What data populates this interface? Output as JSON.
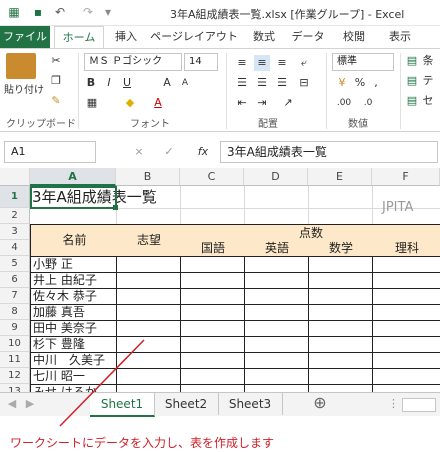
{
  "window": {
    "title": "3年A組成績表一覧.xlsx  [作業グループ] - Excel"
  },
  "tabs": [
    "ファイル",
    "ホーム",
    "挿入",
    "ページレイアウト",
    "数式",
    "データ",
    "校閲",
    "表示"
  ],
  "ribbon": {
    "paste_label": "貼り付け",
    "font_name": "ＭＳ Ｐゴシック",
    "font_size": "14",
    "number_format": "標準",
    "bold": "B",
    "italic": "I",
    "underline": "U",
    "font_a_up": "A",
    "font_a_down": "A",
    "comma": ",",
    "percent": "%",
    "cond_label_1": "条",
    "cond_label_2": "テ",
    "cond_label_3": "セ",
    "groups": [
      "クリップボード",
      "フォント",
      "配置",
      "数値"
    ]
  },
  "formula_bar": {
    "name_box": "A1",
    "fx": "fx",
    "content": "3年A組成績表一覧",
    "cancel": "×",
    "confirm": "✓"
  },
  "grid": {
    "columns": [
      "A",
      "B",
      "C",
      "D",
      "E",
      "F"
    ],
    "rows": [
      "1",
      "2",
      "3",
      "4",
      "5",
      "6",
      "7",
      "8",
      "9",
      "10",
      "11",
      "12",
      "13"
    ],
    "title": "3年A組成績表一覧",
    "watermark": "JPITA",
    "header_name": "名前",
    "header_hope": "志望",
    "header_score": "点数",
    "subjects": [
      "国語",
      "英語",
      "数学",
      "理科"
    ],
    "students": [
      "小野 正",
      "井上 由紀子",
      "佐々木 恭子",
      "加藤 真吾",
      "田中 美奈子",
      "杉下 豊隆",
      "中川　久美子",
      "七川 昭一",
      "みせ はるか"
    ]
  },
  "sheets": [
    "Sheet1",
    "Sheet2",
    "Sheet3"
  ],
  "add_sheet": "⊕",
  "caption": "ワークシートにデータを入力し、表を作成します",
  "colors": {
    "accent": "#217346",
    "header_fill": "#fde9c9",
    "annotation": "#d0202a"
  }
}
